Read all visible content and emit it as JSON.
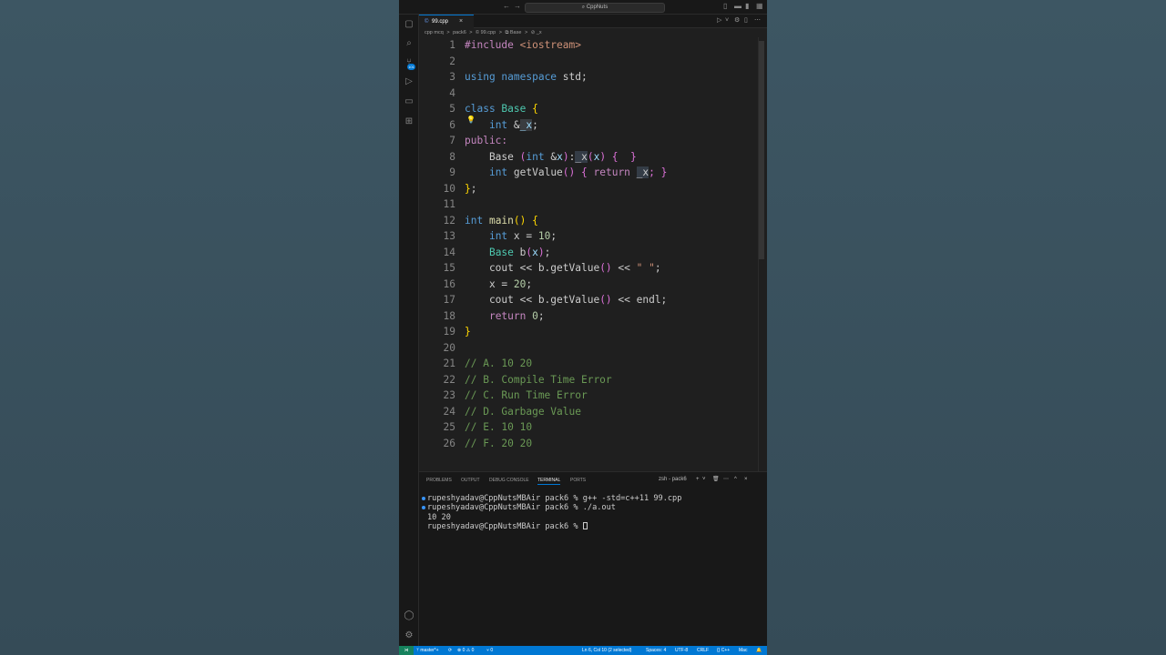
{
  "window": {
    "title_search": "CppNuts"
  },
  "titlebar": {
    "nav_back": "←",
    "nav_forward": "→",
    "search_icon": "⌕",
    "layout_icons": [
      "▯",
      "▬",
      "▮",
      "▦"
    ]
  },
  "activity_bar": {
    "items": [
      {
        "name": "explorer",
        "glyph": "▢"
      },
      {
        "name": "search",
        "glyph": "⌕"
      },
      {
        "name": "source-control",
        "glyph": "⑂"
      },
      {
        "name": "run-debug",
        "glyph": "▷"
      },
      {
        "name": "remote-explorer",
        "glyph": "▭"
      },
      {
        "name": "extensions",
        "glyph": "⊞"
      }
    ],
    "scm_badge": "101",
    "accounts_glyph": "◯",
    "manage_glyph": "⚙"
  },
  "tabs": [
    {
      "label": "99.cpp",
      "icon": "©",
      "close": "×",
      "active": true
    }
  ],
  "tab_actions": [
    "▷",
    "˅",
    "⚙",
    "▯",
    "⋯"
  ],
  "breadcrumb": [
    "cpp mcq",
    ">",
    "pack6",
    ">",
    "© 99.cpp",
    ">",
    "⧉ Base",
    ">",
    "⊘ _x"
  ],
  "editor": {
    "lines": [
      {
        "n": "1"
      },
      {
        "n": "2"
      },
      {
        "n": "3"
      },
      {
        "n": "4"
      },
      {
        "n": "5"
      },
      {
        "n": "6"
      },
      {
        "n": "7"
      },
      {
        "n": "8"
      },
      {
        "n": "9"
      },
      {
        "n": "10"
      },
      {
        "n": "11"
      },
      {
        "n": "12"
      },
      {
        "n": "13"
      },
      {
        "n": "14"
      },
      {
        "n": "15"
      },
      {
        "n": "16"
      },
      {
        "n": "17"
      },
      {
        "n": "18"
      },
      {
        "n": "19"
      },
      {
        "n": "20"
      },
      {
        "n": "21"
      },
      {
        "n": "22"
      },
      {
        "n": "23"
      },
      {
        "n": "24"
      },
      {
        "n": "25"
      },
      {
        "n": "26"
      }
    ],
    "code": {
      "l1_a": "#include ",
      "l1_b": "<iostream>",
      "l3_a": "using",
      "l3_b": " namespace",
      "l3_c": " std;",
      "l5_a": "class",
      "l5_b": " Base",
      "l5_c": " {",
      "l6_a": "    ",
      "l6_b": "int",
      "l6_c": " &",
      "l6_d": "_x",
      "l6_e": ";",
      "l7_a": "public:",
      "l8_a": "    Base ",
      "l8_b": "(",
      "l8_c": "int",
      "l8_d": " &",
      "l8_e": "x",
      "l8_f": ")",
      "l8_g": ":",
      "l8_h": "_x",
      "l8_i": "(",
      "l8_j": "x",
      "l8_k": ")",
      "l8_l": " {  }",
      "l9_a": "    ",
      "l9_b": "int",
      "l9_c": " getValue",
      "l9_d": "()",
      "l9_e": " { ",
      "l9_f": "return",
      "l9_g": " ",
      "l9_h": "_x",
      "l9_i": "; }",
      "l10_a": "}",
      "l10_b": ";",
      "l12_a": "int",
      "l12_b": " main",
      "l12_c": "()",
      "l12_d": " {",
      "l13_a": "    ",
      "l13_b": "int",
      "l13_c": " x = ",
      "l13_d": "10",
      "l13_e": ";",
      "l14_a": "    ",
      "l14_b": "Base",
      "l14_c": " b",
      "l14_d": "(",
      "l14_e": "x",
      "l14_f": ")",
      "l14_g": ";",
      "l15_a": "    cout << b.getValue",
      "l15_b": "()",
      "l15_c": " << ",
      "l15_d": "\" \"",
      "l15_e": ";",
      "l16_a": "    x = ",
      "l16_b": "20",
      "l16_c": ";",
      "l17_a": "    cout << b.getValue",
      "l17_b": "()",
      "l17_c": " << endl;",
      "l18_a": "    ",
      "l18_b": "return",
      "l18_c": " ",
      "l18_d": "0",
      "l18_e": ";",
      "l19_a": "}",
      "l21": "// A. 10 20",
      "l22": "// B. Compile Time Error",
      "l23": "// C. Run Time Error",
      "l24": "// D. Garbage Value",
      "l25": "// E. 10 10",
      "l26": "// F. 20 20"
    },
    "lightbulb": "💡"
  },
  "panel": {
    "tabs": [
      "PROBLEMS",
      "OUTPUT",
      "DEBUG CONSOLE",
      "TERMINAL",
      "PORTS"
    ],
    "active_tab": "TERMINAL",
    "terminal_name": "zsh - pack6",
    "controls": [
      "+",
      "˅",
      "🗑",
      "⋯",
      "^",
      "×"
    ],
    "terminal_lines": [
      "rupeshyadav@CppNutsMBAir pack6 % g++ -std=c++11 99.cpp",
      "rupeshyadav@CppNutsMBAir pack6 % ./a.out",
      "10 20",
      "rupeshyadav@CppNutsMBAir pack6 % "
    ]
  },
  "status_bar": {
    "remote": "⋊",
    "branch": "ᛘ master*+",
    "sync": "⟳",
    "problems": "⊗ 0 ⚠ 0",
    "ports": "⑂ 0",
    "position": "Ln 6, Col 10 (2 selected)",
    "spaces": "Spaces: 4",
    "encoding": "UTF-8",
    "eol": "CRLF",
    "language": "{} C++",
    "platform": "Mac",
    "bell": "🔔"
  },
  "colors": {
    "accent": "#0078d4",
    "editor_bg": "#1f1f1f",
    "remote_green": "#16825d"
  }
}
